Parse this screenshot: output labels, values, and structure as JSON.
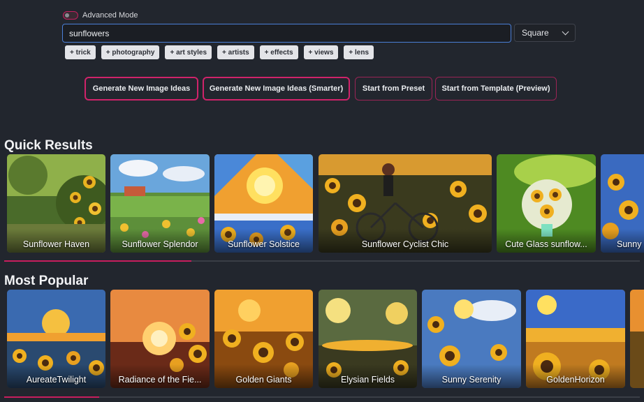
{
  "advanced_mode": {
    "label": "Advanced Mode",
    "enabled": false
  },
  "search": {
    "value": "sunflowers",
    "placeholder": ""
  },
  "aspect_select": {
    "selected": "Square"
  },
  "chips": [
    "+ trick",
    "+ photography",
    "+ art styles",
    "+ artists",
    "+ effects",
    "+ views",
    "+ lens"
  ],
  "actions": {
    "generate": "Generate New Image Ideas",
    "generate_smarter": "Generate New Image Ideas (Smarter)",
    "preset": "Start from Preset",
    "template": "Start from Template (Preview)"
  },
  "quick_results": {
    "title": "Quick Results",
    "cards": [
      {
        "label": "Sunflower Haven"
      },
      {
        "label": "Sunflower Splendor"
      },
      {
        "label": "Sunflower Solstice"
      },
      {
        "label": "Sunflower Cyclist Chic"
      },
      {
        "label": "Cute Glass sunflow..."
      },
      {
        "label": "Sunny"
      }
    ]
  },
  "most_popular": {
    "title": "Most Popular",
    "cards": [
      {
        "label": "AureateTwilight"
      },
      {
        "label": "Radiance of the Fie..."
      },
      {
        "label": "Golden Giants"
      },
      {
        "label": "Elysian Fields"
      },
      {
        "label": "Sunny Serenity"
      },
      {
        "label": "GoldenHorizon"
      },
      {
        "label": ""
      }
    ]
  },
  "colors": {
    "accent": "#c81e5e",
    "background": "#22262e",
    "focus": "#4a7fd8"
  }
}
